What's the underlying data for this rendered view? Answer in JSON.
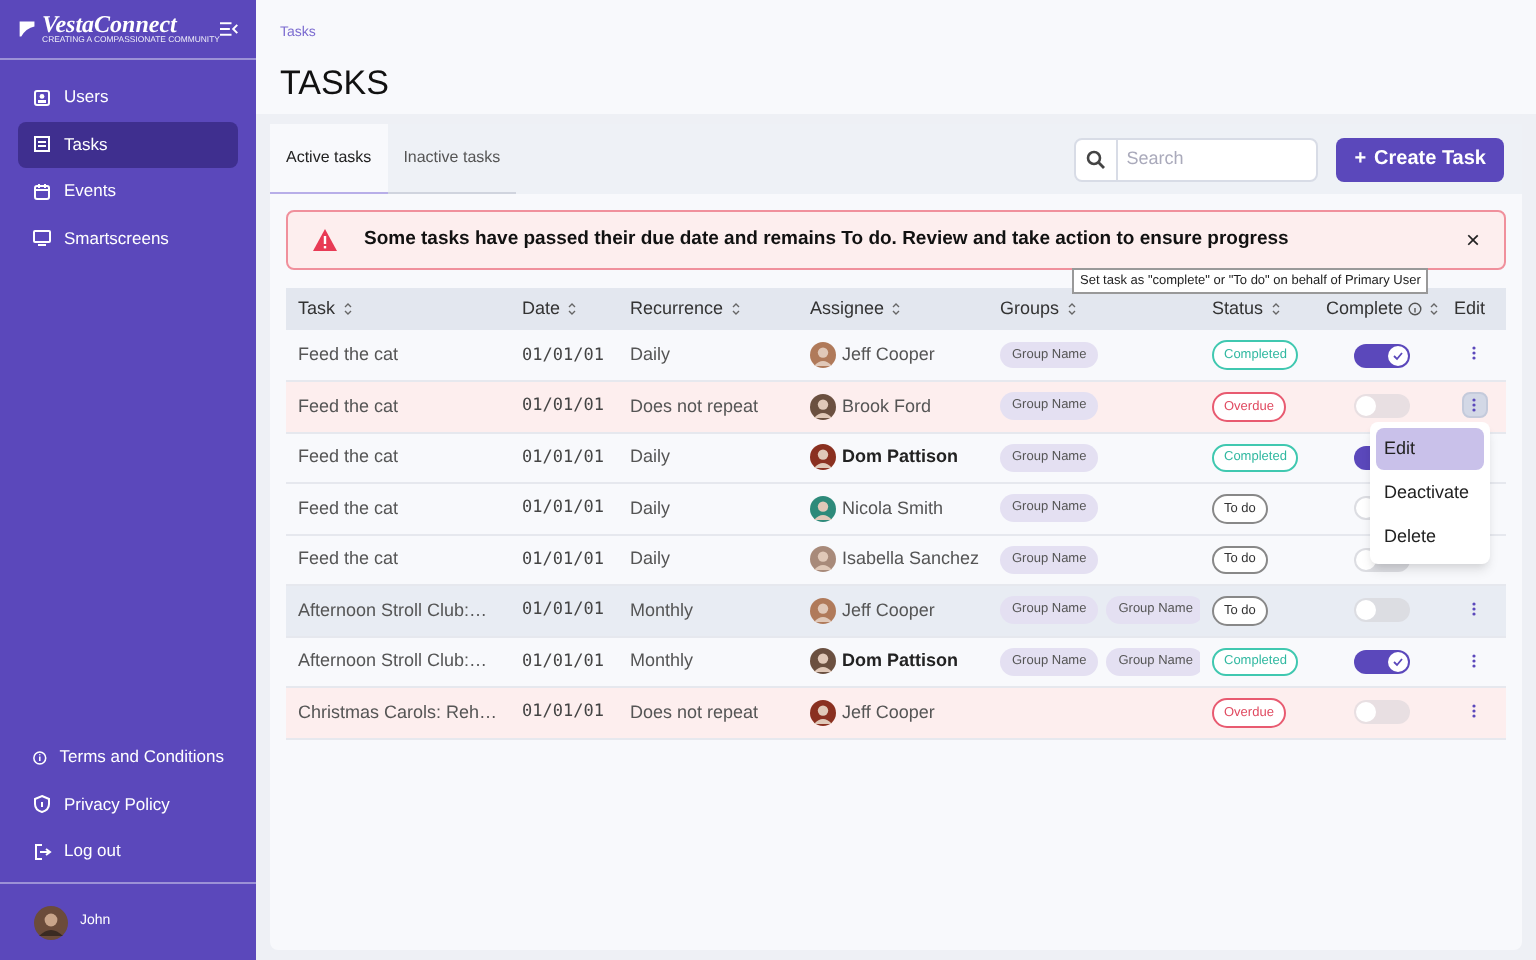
{
  "sidebar": {
    "logo": {
      "name": "VestaConnect",
      "tagline": "CREATING A COMPASSIONATE COMMUNITY"
    },
    "items": [
      {
        "label": "Users",
        "selected": false
      },
      {
        "label": "Tasks",
        "selected": true
      },
      {
        "label": "Events",
        "selected": false
      },
      {
        "label": "Smartscreens",
        "selected": false
      }
    ],
    "footer_items": [
      {
        "label": "Terms and Conditions"
      },
      {
        "label": "Privacy Policy"
      },
      {
        "label": "Log out"
      }
    ],
    "user": {
      "name": "John"
    }
  },
  "breadcrumb": "Tasks",
  "title": "TASKS",
  "tabs": [
    {
      "label": "Active tasks",
      "selected": true
    },
    {
      "label": "Inactive tasks",
      "selected": false
    }
  ],
  "search": {
    "placeholder": "Search"
  },
  "create_button": {
    "icon": "+",
    "label": "Create Task"
  },
  "alert": {
    "message": "Some tasks have passed their due date and remains To do. Review and take action to ensure progress",
    "close": "×"
  },
  "table": {
    "columns": [
      {
        "label": "Task",
        "sortable": true
      },
      {
        "label": "Date",
        "sortable": true
      },
      {
        "label": "Recurrence",
        "sortable": true
      },
      {
        "label": "Assignee",
        "sortable": true
      },
      {
        "label": "Groups",
        "sortable": true
      },
      {
        "label": "Status",
        "sortable": true
      },
      {
        "label": "Complete",
        "sortable": true,
        "info": true
      },
      {
        "label": "Edit",
        "sortable": false
      }
    ],
    "rows": [
      {
        "task": "Feed the cat",
        "date": "01/01/01",
        "recurrence": "Daily",
        "assignee": "Jeff Cooper",
        "assignee_bold": false,
        "groups": [
          "Group Name"
        ],
        "status": {
          "label": "Completed",
          "kind": "completed"
        },
        "complete": true,
        "hovered": false,
        "menu_open": false
      },
      {
        "task": "Feed the cat",
        "date": "01/01/01",
        "recurrence": "Does not repeat",
        "assignee": "Brook Ford",
        "assignee_bold": false,
        "groups": [
          "Group Name"
        ],
        "status": {
          "label": "Overdue",
          "kind": "overdue"
        },
        "complete": false,
        "hovered": false,
        "menu_open": true
      },
      {
        "task": "Feed the cat",
        "date": "01/01/01",
        "recurrence": "Daily",
        "assignee": "Dom Pattison",
        "assignee_bold": true,
        "groups": [
          "Group Name"
        ],
        "status": {
          "label": "Completed",
          "kind": "completed"
        },
        "complete": true,
        "hovered": false
      },
      {
        "task": "Feed the cat",
        "date": "01/01/01",
        "recurrence": "Daily",
        "assignee": "Nicola Smith",
        "assignee_bold": false,
        "groups": [
          "Group Name"
        ],
        "status": {
          "label": "To do",
          "kind": "todo"
        },
        "complete": false,
        "hovered": false
      },
      {
        "task": "Feed the cat",
        "date": "01/01/01",
        "recurrence": "Daily",
        "assignee": "Isabella Sanchez",
        "assignee_bold": false,
        "groups": [
          "Group Name"
        ],
        "status": {
          "label": "To do",
          "kind": "todo"
        },
        "complete": false,
        "hovered": false
      },
      {
        "task": "Afternoon Stroll Club:…",
        "date": "01/01/01",
        "recurrence": "Monthly",
        "assignee": "Jeff Cooper",
        "assignee_bold": false,
        "groups": [
          "Group Name",
          "Group Name"
        ],
        "status": {
          "label": "To do",
          "kind": "todo"
        },
        "complete": false,
        "hovered": true,
        "menu_open": false
      },
      {
        "task": "Afternoon Stroll Club:…",
        "date": "01/01/01",
        "recurrence": "Monthly",
        "assignee": "Dom Pattison",
        "assignee_bold": true,
        "groups": [
          "Group Name",
          "Group Name"
        ],
        "status": {
          "label": "Completed",
          "kind": "completed"
        },
        "complete": true,
        "hovered": false,
        "menu_open": false
      },
      {
        "task": "Christmas Carols: Reh…",
        "date": "01/01/01",
        "recurrence": "Does not repeat",
        "assignee": "Jeff Cooper",
        "assignee_bold": false,
        "groups": [],
        "status": {
          "label": "Overdue",
          "kind": "overdue"
        },
        "complete": false,
        "hovered": false,
        "menu_open": false
      }
    ]
  },
  "tooltip": "Set task as \"complete\" or \"To do\" on behalf of Primary User",
  "row_menu": {
    "items": [
      {
        "label": "Edit",
        "selected": true
      },
      {
        "label": "Deactivate",
        "selected": false
      },
      {
        "label": "Delete",
        "selected": false
      }
    ]
  }
}
